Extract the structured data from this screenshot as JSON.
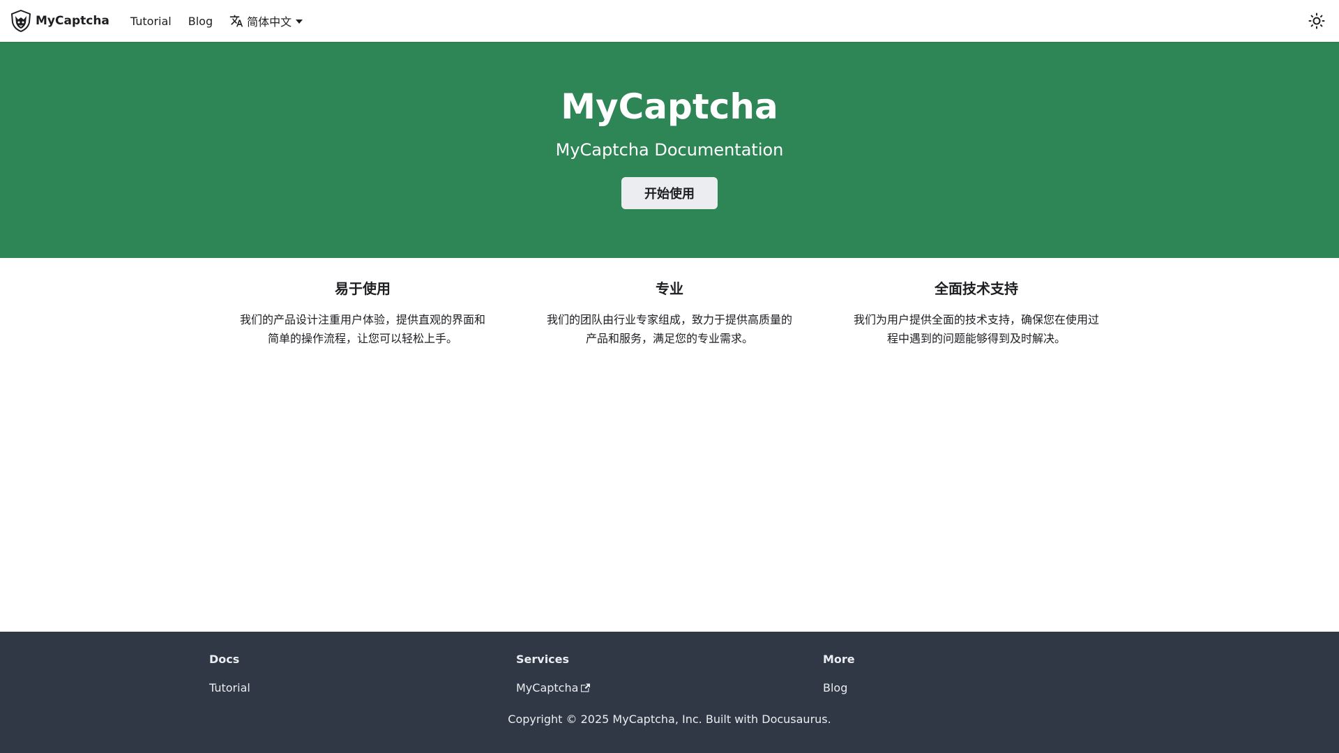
{
  "navbar": {
    "brand_title": "MyCaptcha",
    "links": [
      "Tutorial",
      "Blog"
    ],
    "language": "简体中文"
  },
  "hero": {
    "title": "MyCaptcha",
    "subtitle": "MyCaptcha Documentation",
    "button_label": "开始使用",
    "background_color": "#2e8555"
  },
  "features": [
    {
      "title": "易于使用",
      "description": "我们的产品设计注重用户体验，提供直观的界面和简单的操作流程，让您可以轻松上手。"
    },
    {
      "title": "专业",
      "description": "我们的团队由行业专家组成，致力于提供高质量的产品和服务，满足您的专业需求。"
    },
    {
      "title": "全面技术支持",
      "description": "我们为用户提供全面的技术支持，确保您在使用过程中遇到的问题能够得到及时解决。"
    }
  ],
  "footer": {
    "columns": [
      {
        "title": "Docs",
        "link": "Tutorial"
      },
      {
        "title": "Services",
        "link": "MyCaptcha",
        "external": true
      },
      {
        "title": "More",
        "link": "Blog"
      }
    ],
    "copyright": "Copyright © 2025 MyCaptcha, Inc. Built with Docusaurus.",
    "background_color": "#303846"
  },
  "icons": {
    "logo": "shield-cat-logo",
    "translate": "translate-icon",
    "dropdown": "caret-down-icon",
    "theme": "sun-icon",
    "external": "external-link-icon"
  }
}
